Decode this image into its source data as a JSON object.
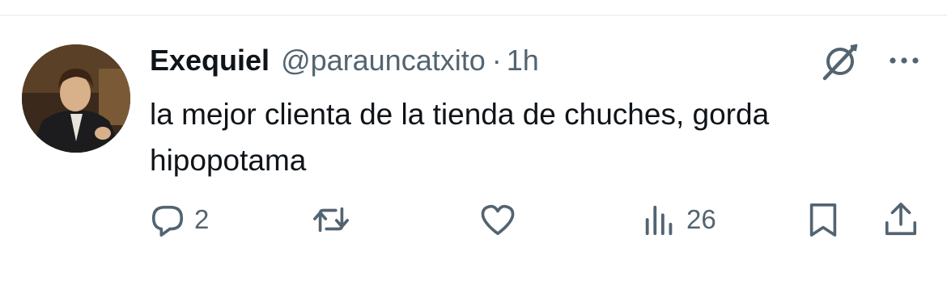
{
  "tweet": {
    "author_name": "Exequiel",
    "handle": "@parauncatxito",
    "separator": "·",
    "time": "1h",
    "text": "la mejor clienta de la tienda de chuches, gorda hipopotama"
  },
  "actions": {
    "replies": "2",
    "reposts": "",
    "likes": "",
    "views": "26"
  },
  "icons": {
    "grok": "grok-icon",
    "more": "more-icon",
    "reply": "reply-icon",
    "repost": "repost-icon",
    "like": "like-icon",
    "views": "views-icon",
    "bookmark": "bookmark-icon",
    "share": "share-icon"
  },
  "colors": {
    "text": "#0f1419",
    "muted": "#536471",
    "icon": "#536471",
    "divider": "#eff3f4"
  }
}
